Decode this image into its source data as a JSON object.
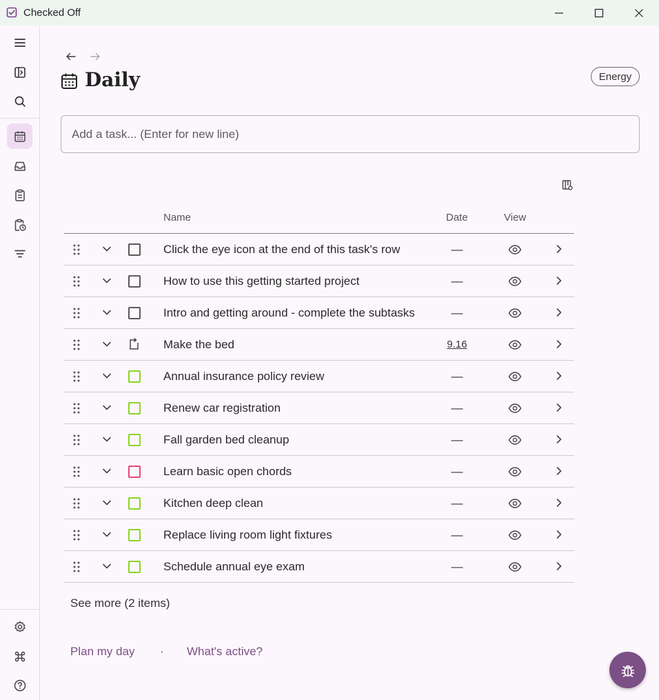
{
  "window": {
    "title": "Checked Off"
  },
  "page": {
    "title": "Daily",
    "energy_label": "Energy",
    "task_input_placeholder": "Add a task... (Enter for new line)"
  },
  "table": {
    "columns": {
      "name": "Name",
      "date": "Date",
      "view": "View"
    },
    "rows": [
      {
        "name": "Click the eye icon at the end of this task's row",
        "date": "—",
        "check": "default"
      },
      {
        "name": "How to use this getting started project",
        "date": "—",
        "check": "default"
      },
      {
        "name": "Intro and getting around - complete the subtasks",
        "date": "—",
        "check": "default"
      },
      {
        "name": "Make the bed",
        "date": "9.16",
        "check": "repeat"
      },
      {
        "name": "Annual insurance policy review",
        "date": "—",
        "check": "green"
      },
      {
        "name": "Renew car registration",
        "date": "—",
        "check": "green"
      },
      {
        "name": "Fall garden bed cleanup",
        "date": "—",
        "check": "green"
      },
      {
        "name": "Learn basic open chords",
        "date": "—",
        "check": "pink"
      },
      {
        "name": "Kitchen deep clean",
        "date": "—",
        "check": "green"
      },
      {
        "name": "Replace living room light fixtures",
        "date": "—",
        "check": "green"
      },
      {
        "name": "Schedule annual eye exam",
        "date": "—",
        "check": "green"
      }
    ]
  },
  "see_more": "See more (2 items)",
  "footer": {
    "plan_my_day": "Plan my day",
    "separator": "·",
    "whats_active": "What's active?"
  },
  "colors": {
    "accent": "#7c4f86",
    "active_nav_bg": "#f0dcf2",
    "check_green": "#8cd42c",
    "check_pink": "#e6497c"
  }
}
